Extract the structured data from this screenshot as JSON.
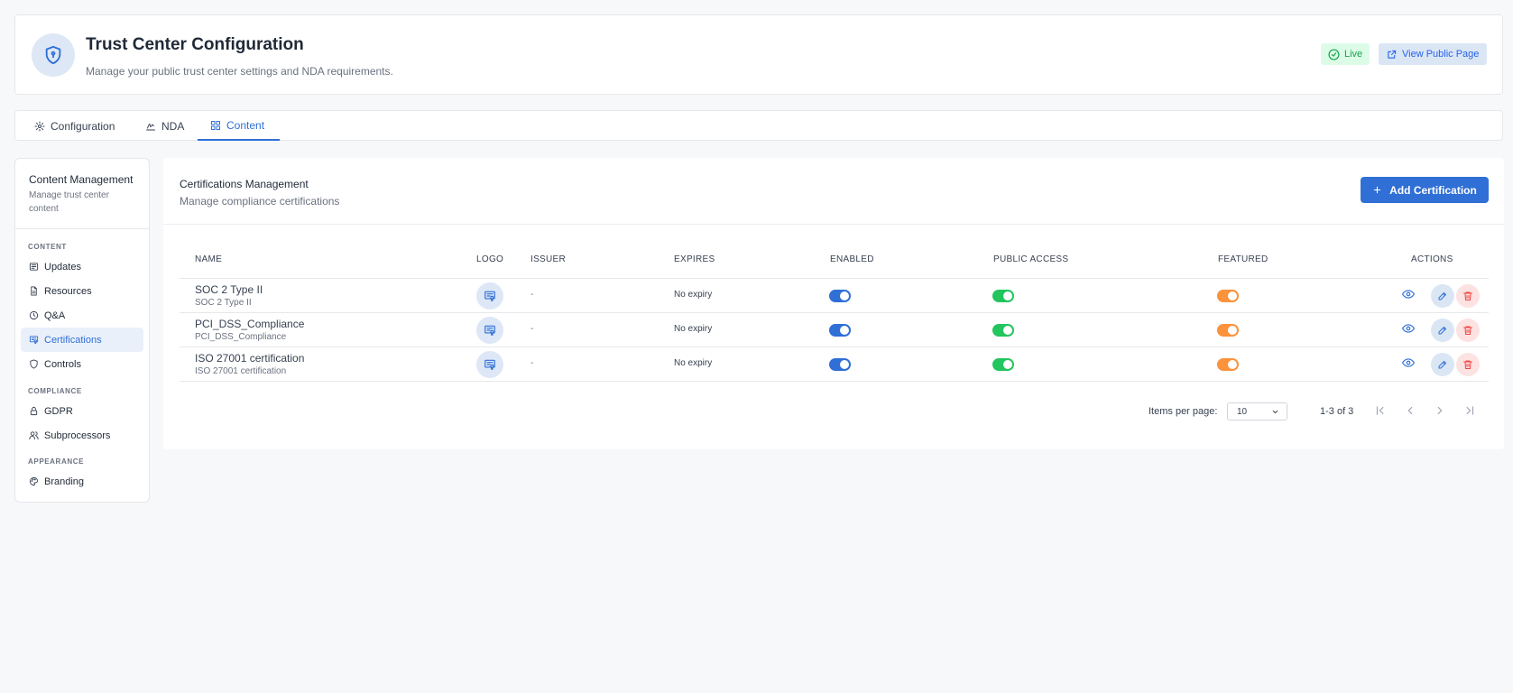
{
  "header": {
    "title": "Trust Center Configuration",
    "subtitle": "Manage your public trust center settings and NDA requirements.",
    "status_badge": "Live",
    "view_public_label": "View Public Page"
  },
  "tabs": [
    {
      "label": "Configuration",
      "icon": "gear-icon"
    },
    {
      "label": "NDA",
      "icon": "signature-icon"
    },
    {
      "label": "Content",
      "icon": "grid-icon",
      "active": true
    }
  ],
  "sidebar": {
    "title": "Content Management",
    "subtitle": "Manage trust center content",
    "sections": [
      {
        "label": "CONTENT",
        "items": [
          {
            "label": "Updates",
            "icon": "newspaper-icon"
          },
          {
            "label": "Resources",
            "icon": "file-icon"
          },
          {
            "label": "Q&A",
            "icon": "clock-icon"
          },
          {
            "label": "Certifications",
            "icon": "certificate-icon",
            "active": true
          },
          {
            "label": "Controls",
            "icon": "shield-icon"
          }
        ]
      },
      {
        "label": "COMPLIANCE",
        "items": [
          {
            "label": "GDPR",
            "icon": "lock-icon"
          },
          {
            "label": "Subprocessors",
            "icon": "users-icon"
          }
        ]
      },
      {
        "label": "APPEARANCE",
        "items": [
          {
            "label": "Branding",
            "icon": "palette-icon"
          }
        ]
      }
    ]
  },
  "main": {
    "title": "Certifications Management",
    "subtitle": "Manage compliance certifications",
    "add_label": "Add Certification",
    "columns": [
      "NAME",
      "LOGO",
      "ISSUER",
      "EXPIRES",
      "ENABLED",
      "PUBLIC ACCESS",
      "FEATURED",
      "ACTIONS"
    ],
    "rows": [
      {
        "name": "SOC 2 Type II",
        "subname": "SOC 2 Type II",
        "issuer": "-",
        "expires": "No expiry",
        "enabled": true,
        "public_access": true,
        "featured": true
      },
      {
        "name": "PCI_DSS_Compliance",
        "subname": "PCI_DSS_Compliance",
        "issuer": "-",
        "expires": "No expiry",
        "enabled": true,
        "public_access": true,
        "featured": true
      },
      {
        "name": "ISO 27001 certification",
        "subname": "ISO 27001 certification",
        "issuer": "-",
        "expires": "No expiry",
        "enabled": true,
        "public_access": true,
        "featured": true
      }
    ],
    "pagination": {
      "items_per_page_label": "Items per page:",
      "items_per_page": "10",
      "range": "1-3 of 3"
    }
  },
  "colors": {
    "accent": "#2f6fd6",
    "live": "#16a34a",
    "toggle_public": "#22c55e",
    "toggle_featured": "#fb923c",
    "delete": "#ef4444"
  }
}
